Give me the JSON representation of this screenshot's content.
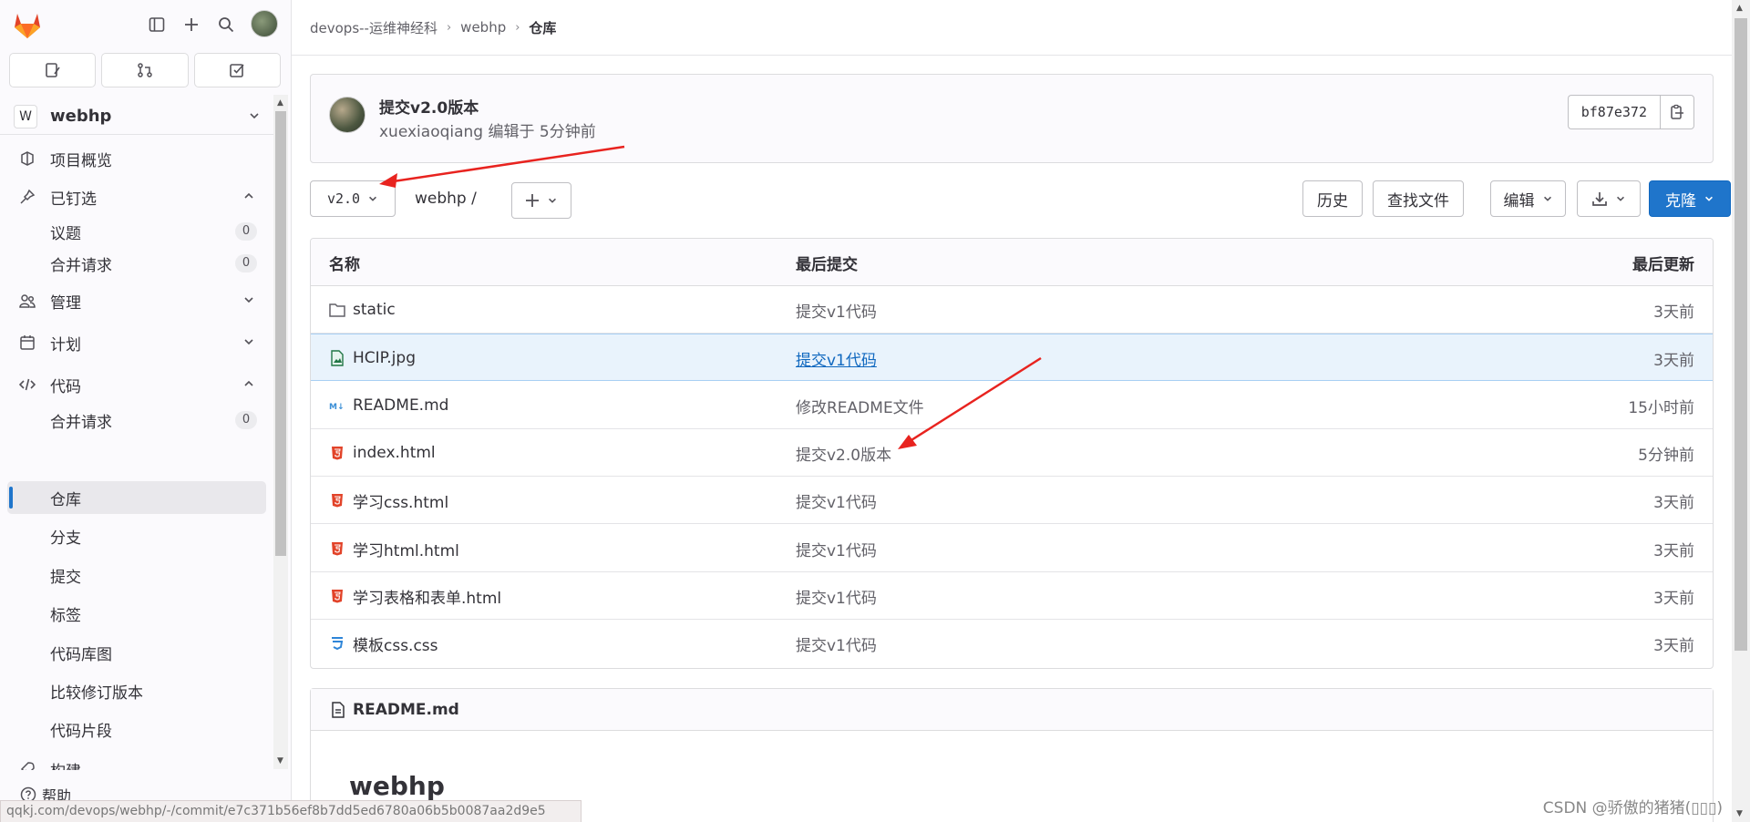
{
  "sidebar": {
    "project_initial": "W",
    "project_name": "webhp",
    "nav": {
      "overview": "项目概览",
      "pinned": "已钉选",
      "pinned_issues": "议题",
      "pinned_issues_count": "0",
      "pinned_mr": "合并请求",
      "pinned_mr_count": "0",
      "manage": "管理",
      "plan": "计划",
      "code": "代码",
      "code_mr": "合并请求",
      "code_mr_count": "0",
      "repository": "仓库",
      "branches": "分支",
      "commits": "提交",
      "tags": "标签",
      "graph": "代码库图",
      "compare": "比较修订版本",
      "snippets": "代码片段",
      "build": "构建"
    },
    "help": "帮助"
  },
  "breadcrumb": {
    "group": "devops--运维神经科",
    "project": "webhp",
    "current": "仓库"
  },
  "last_commit": {
    "title": "提交v2.0版本",
    "author": "xuexiaoqiang",
    "meta_suffix": " 编辑于 5分钟前",
    "sha": "bf87e372"
  },
  "toolbar": {
    "ref": "v2.0",
    "path": "webhp  /",
    "history": "历史",
    "find_file": "查找文件",
    "edit": "编辑",
    "clone": "克隆"
  },
  "table": {
    "headers": [
      "名称",
      "最后提交",
      "最后更新"
    ],
    "rows": [
      {
        "name": "static",
        "commit": "提交v1代码",
        "date": "3天前"
      },
      {
        "name": "HCIP.jpg",
        "commit": "提交v1代码",
        "date": "3天前"
      },
      {
        "name": "README.md",
        "commit": "修改README文件",
        "date": "15小时前"
      },
      {
        "name": "index.html",
        "commit": "提交v2.0版本",
        "date": "5分钟前"
      },
      {
        "name": "学习css.html",
        "commit": "提交v1代码",
        "date": "3天前"
      },
      {
        "name": "学习html.html",
        "commit": "提交v1代码",
        "date": "3天前"
      },
      {
        "name": "学习表格和表单.html",
        "commit": "提交v1代码",
        "date": "3天前"
      },
      {
        "name": "模板css.css",
        "commit": "提交v1代码",
        "date": "3天前"
      }
    ]
  },
  "readme": {
    "filename": "README.md",
    "heading": "webhp"
  },
  "status_url": "qqkj.com/devops/webhp/-/commit/e7c371b56ef8b7dd5ed6780a06b5b0087aa2d9e5",
  "watermark": "CSDN @骄傲的猪猪(▯▯▯)",
  "colors": {
    "accent": "#1f75cb",
    "annotation": "#e8231f",
    "html_icon": "#e24329",
    "css_icon": "#2e85d8",
    "md_icon": "#3b8fd6"
  }
}
